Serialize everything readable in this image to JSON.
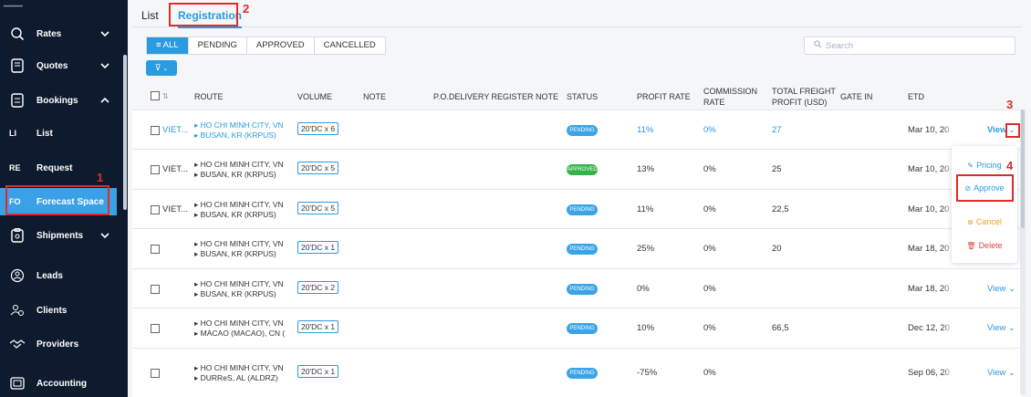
{
  "sidebar": {
    "items": [
      {
        "label": "Rates",
        "icon": "search-money-icon",
        "chevron": "down"
      },
      {
        "label": "Quotes",
        "icon": "document-icon",
        "chevron": "down"
      },
      {
        "label": "Bookings",
        "icon": "file-icon",
        "chevron": "up"
      },
      {
        "abbr": "LI",
        "label": "List"
      },
      {
        "abbr": "RE",
        "label": "Request"
      },
      {
        "abbr": "FO",
        "label": "Forecast Space",
        "active": true
      },
      {
        "label": "Shipments",
        "icon": "clipboard-icon",
        "chevron": "down"
      },
      {
        "label": "Leads",
        "icon": "people-icon"
      },
      {
        "label": "Clients",
        "icon": "client-icon"
      },
      {
        "label": "Providers",
        "icon": "handshake-icon"
      },
      {
        "label": "Accounting",
        "icon": "calculator-icon"
      }
    ]
  },
  "annotations": {
    "n1": "1",
    "n2": "2",
    "n3": "3",
    "n4": "4"
  },
  "tabs": [
    {
      "label": "List"
    },
    {
      "label": "Registration",
      "active": true
    }
  ],
  "filters": {
    "all": "ALL",
    "pending": "PENDING",
    "approved": "APPROVED",
    "cancelled": "CANCELLED"
  },
  "search": {
    "placeholder": "Search"
  },
  "table": {
    "headers": {
      "route": "ROUTE",
      "volume": "VOLUME",
      "note": "NOTE",
      "po_note": "P.O.DELIVERY REGISTER NOTE",
      "status": "STATUS",
      "profit_rate": "PROFIT RATE",
      "commission_rate_1": "COMMISSION",
      "commission_rate_2": "RATE",
      "total_freight_1": "TOTAL FREIGHT",
      "total_freight_2": "PROFIT (USD)",
      "gate_in": "GATE IN",
      "etd": "ETD"
    },
    "rows": [
      {
        "client": "VIET...",
        "from": "HO CHI MINH CITY, VN",
        "to": "BUSAN, KR (KRPUS)",
        "volume": "20'DC x 6",
        "status": "PENDING",
        "profit_rate": "11%",
        "commission_rate": "0%",
        "total_freight": "27",
        "etd": "Mar 10, 20",
        "view": "View"
      },
      {
        "client": "VIET...",
        "from": "HO CHI MINH CITY, VN",
        "to": "BUSAN, KR (KRPUS)",
        "volume": "20'DC x 5",
        "status": "APPROVED",
        "profit_rate": "13%",
        "commission_rate": "0%",
        "total_freight": "25",
        "etd": "Mar 10, 20",
        "view": ""
      },
      {
        "client": "VIET...",
        "from": "HO CHI MINH CITY, VN",
        "to": "BUSAN, KR (KRPUS)",
        "volume": "20'DC x 5",
        "status": "PENDING",
        "profit_rate": "11%",
        "commission_rate": "0%",
        "total_freight": "22,5",
        "etd": "Mar 10, 20",
        "view": ""
      },
      {
        "client": "",
        "from": "HO CHI MINH CITY, VN",
        "to": "BUSAN, KR (KRPUS)",
        "volume": "20'DC x 1",
        "status": "PENDING",
        "profit_rate": "25%",
        "commission_rate": "0%",
        "total_freight": "20",
        "etd": "Mar 18, 20",
        "view": ""
      },
      {
        "client": "",
        "from": "HO CHI MINH CITY, VN",
        "to": "BUSAN, KR (KRPUS)",
        "volume": "20'DC x 2",
        "status": "PENDING",
        "profit_rate": "0%",
        "commission_rate": "0%",
        "total_freight": "",
        "etd": "Mar 18, 20",
        "view": "View"
      },
      {
        "client": "",
        "from": "HO CHI MINH CITY, VN",
        "to": "MACAO (MACAO), CN (",
        "volume": "20'DC x 1",
        "status": "PENDING",
        "profit_rate": "10%",
        "commission_rate": "0%",
        "total_freight": "66,5",
        "etd": "Dec 12, 20",
        "view": "View"
      },
      {
        "client": "",
        "from": "HO CHI MINH CITY, VN",
        "to": "DURReS, AL (ALDRZ)",
        "volume": "20'DC x 1",
        "status": "PENDING",
        "profit_rate": "-75%",
        "commission_rate": "0%",
        "total_freight": "",
        "etd": "Sep 06, 20",
        "view": "View"
      }
    ]
  },
  "menu": {
    "pricing": "Pricing",
    "approve": "Approve",
    "cancel": "Cancel",
    "delete": "Delete"
  },
  "colors": {
    "accent": "#2a9be0",
    "sidebar_bg": "#0e1b2e",
    "approved": "#36b24a",
    "cancel": "#f0a020",
    "delete": "#e04848",
    "annotation": "#e02b2b"
  }
}
